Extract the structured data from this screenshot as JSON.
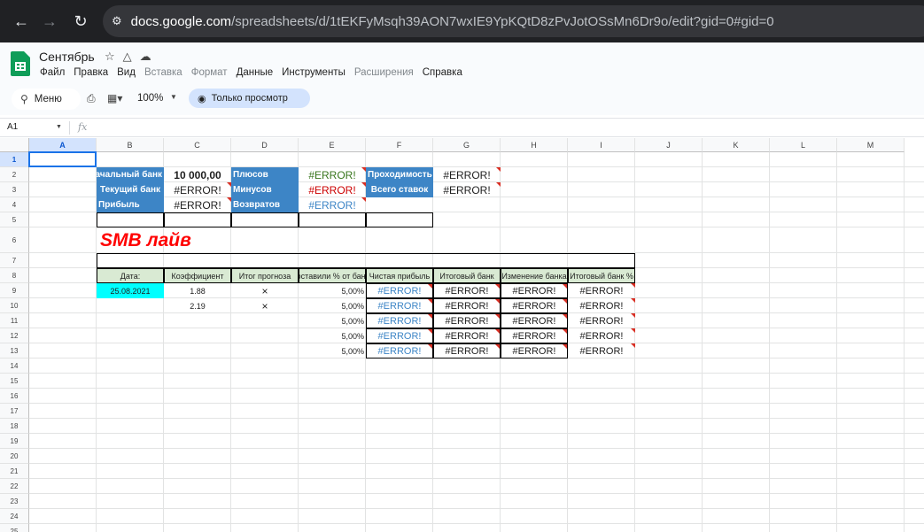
{
  "browser": {
    "url_host": "docs.google.com",
    "url_rest": "/spreadsheets/d/1tEKFyMsqh39AON7wxIE9YpKQtD8zPvJotOSsMn6Dr9o/edit?gid=0#gid=0"
  },
  "doc": {
    "title": "Сентябрь",
    "menu": [
      "Файл",
      "Правка",
      "Вид",
      "Вставка",
      "Формат",
      "Данные",
      "Инструменты",
      "Расширения",
      "Справка"
    ]
  },
  "toolbar": {
    "search_label": "Меню",
    "zoom": "100%",
    "view_only_label": "Только просмотр"
  },
  "formula_bar": {
    "name_box": "A1",
    "fx": "fx"
  },
  "grid": {
    "columns": [
      "A",
      "B",
      "C",
      "D",
      "E",
      "F",
      "G",
      "H",
      "I",
      "J",
      "K",
      "L",
      "M"
    ],
    "rows": [
      "1",
      "2",
      "3",
      "4",
      "5",
      "6",
      "7",
      "8",
      "9",
      "10",
      "11",
      "12",
      "13",
      "14",
      "15",
      "16",
      "17",
      "18",
      "19",
      "20",
      "21",
      "22",
      "23",
      "24",
      "25"
    ],
    "summary": {
      "start_bank_label": "Начальный банк",
      "start_bank_value": "10 000,00",
      "current_bank_label": "Текущий банк",
      "current_bank_value": "#ERROR!",
      "profit_label": "Прибыль",
      "profit_value": "#ERROR!",
      "plus_label": "Плюсов",
      "plus_value": "#ERROR!",
      "minus_label": "Минусов",
      "minus_value": "#ERROR!",
      "returns_label": "Возвратов",
      "returns_value": "#ERROR!",
      "pass_label": "Проходимость",
      "pass_value": "#ERROR!",
      "total_bets_label": "Всего ставок",
      "total_bets_value": "#ERROR!"
    },
    "section_title": "SMB лайв",
    "table_headers": [
      "Дата:",
      "Коэффициент",
      "Итог прогноза",
      "Поставили % от банка",
      "Чистая прибыль",
      "Итоговый банк",
      "Изменение банка",
      "Итоговый банк %"
    ],
    "table_rows": [
      {
        "date": "25.08.2021",
        "coef": "1.88",
        "result": "×",
        "stake": "5,00%",
        "net": "#ERROR!",
        "bank": "#ERROR!",
        "change": "#ERROR!",
        "bank_pct": "#ERROR!"
      },
      {
        "date": "",
        "coef": "2.19",
        "result": "×",
        "stake": "5,00%",
        "net": "#ERROR!",
        "bank": "#ERROR!",
        "change": "#ERROR!",
        "bank_pct": "#ERROR!"
      },
      {
        "date": "",
        "coef": "",
        "result": "",
        "stake": "5,00%",
        "net": "#ERROR!",
        "bank": "#ERROR!",
        "change": "#ERROR!",
        "bank_pct": "#ERROR!"
      },
      {
        "date": "",
        "coef": "",
        "result": "",
        "stake": "5,00%",
        "net": "#ERROR!",
        "bank": "#ERROR!",
        "change": "#ERROR!",
        "bank_pct": "#ERROR!"
      },
      {
        "date": "",
        "coef": "",
        "result": "",
        "stake": "5,00%",
        "net": "#ERROR!",
        "bank": "#ERROR!",
        "change": "#ERROR!",
        "bank_pct": "#ERROR!"
      }
    ]
  },
  "colors": {
    "blue_header": "#3d85c6",
    "green_header": "#d9ead3",
    "cyan_cell": "#00ffff",
    "error_green": "#38761d",
    "error_red": "#cc0000",
    "error_blue": "#3d85c6",
    "title_red": "#ff0000",
    "selection": "#1a73e8"
  }
}
